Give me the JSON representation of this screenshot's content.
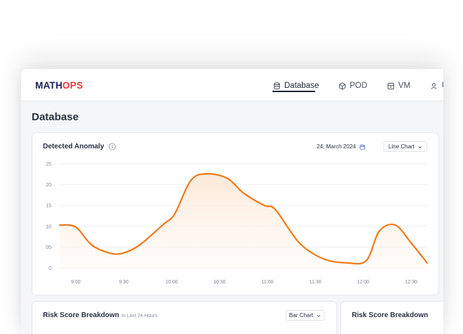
{
  "app": {
    "logo_part1": "MATH",
    "logo_part2": "OPS"
  },
  "nav": {
    "items": [
      {
        "label": "Database",
        "icon": "database-icon"
      },
      {
        "label": "POD",
        "icon": "cube-icon"
      },
      {
        "label": "VM",
        "icon": "server-icon"
      },
      {
        "label": "U",
        "icon": "user-icon"
      }
    ],
    "active": "Database"
  },
  "page": {
    "title": "Database"
  },
  "anomaly_card": {
    "title": "Detected Anomaly",
    "date": "24, March 2024",
    "chart_type_select": "Line Chart"
  },
  "chart_data": {
    "type": "area",
    "title": "",
    "xlabel": "",
    "ylabel": "",
    "y_tick_labels": [
      "25",
      "20",
      "15",
      "10",
      "05",
      "0"
    ],
    "y_tick_values": [
      25,
      20,
      15,
      10,
      5,
      0
    ],
    "ylim": [
      0,
      25
    ],
    "x_tick_labels": [
      "9:00",
      "9:30",
      "10:00",
      "10:30",
      "11:00",
      "11:30",
      "12:00",
      "12:30"
    ],
    "x_tick_minutes_since_first": [
      0,
      30,
      60,
      90,
      120,
      150,
      180,
      210
    ],
    "points_minutes_since_first": [
      -10,
      0,
      10,
      22,
      30,
      40,
      55,
      62,
      72,
      82,
      95,
      105,
      118,
      125,
      140,
      155,
      170,
      182,
      190,
      200,
      210,
      220
    ],
    "points_values": [
      10.3,
      9.8,
      5.5,
      3.5,
      3.6,
      5.5,
      10.5,
      13,
      21,
      22.6,
      21.5,
      18,
      15,
      14,
      6,
      2.2,
      1.2,
      1.8,
      8.8,
      10.3,
      6,
      1.2
    ],
    "series": [
      {
        "name": "",
        "color": "#f07a1a"
      }
    ],
    "grid": true,
    "legend": "none",
    "fill_color": "#fde9d8"
  },
  "risk_cards": [
    {
      "title": "Risk Score Breakdown",
      "subtitle": "In Last 24 Hours",
      "select": "Bar Chart"
    },
    {
      "title": "Risk Score Breakdown",
      "subtitle": "",
      "select": ""
    }
  ]
}
